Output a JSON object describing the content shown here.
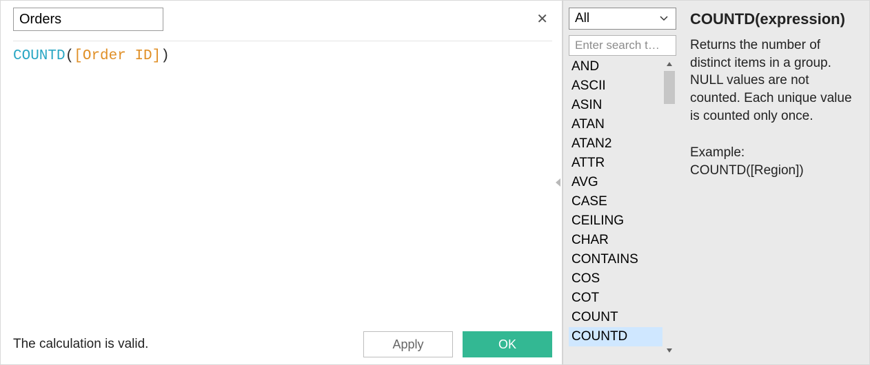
{
  "editor": {
    "title": "Orders",
    "formula": {
      "func": "COUNTD",
      "open": "(",
      "field": "[Order ID]",
      "close": ")"
    },
    "status": "The calculation is valid.",
    "apply_label": "Apply",
    "ok_label": "OK"
  },
  "reference": {
    "category": "All",
    "search_placeholder": "Enter search t…",
    "functions": [
      "AND",
      "ASCII",
      "ASIN",
      "ATAN",
      "ATAN2",
      "ATTR",
      "AVG",
      "CASE",
      "CEILING",
      "CHAR",
      "CONTAINS",
      "COS",
      "COT",
      "COUNT",
      "COUNTD"
    ],
    "selected_function": "COUNTD"
  },
  "doc": {
    "signature": "COUNTD(expression)",
    "description": "Returns the number of distinct items in a group.  NULL values are not counted.  Each unique value is counted only once.",
    "example_label": "Example:",
    "example_code": "COUNTD([Region])"
  }
}
